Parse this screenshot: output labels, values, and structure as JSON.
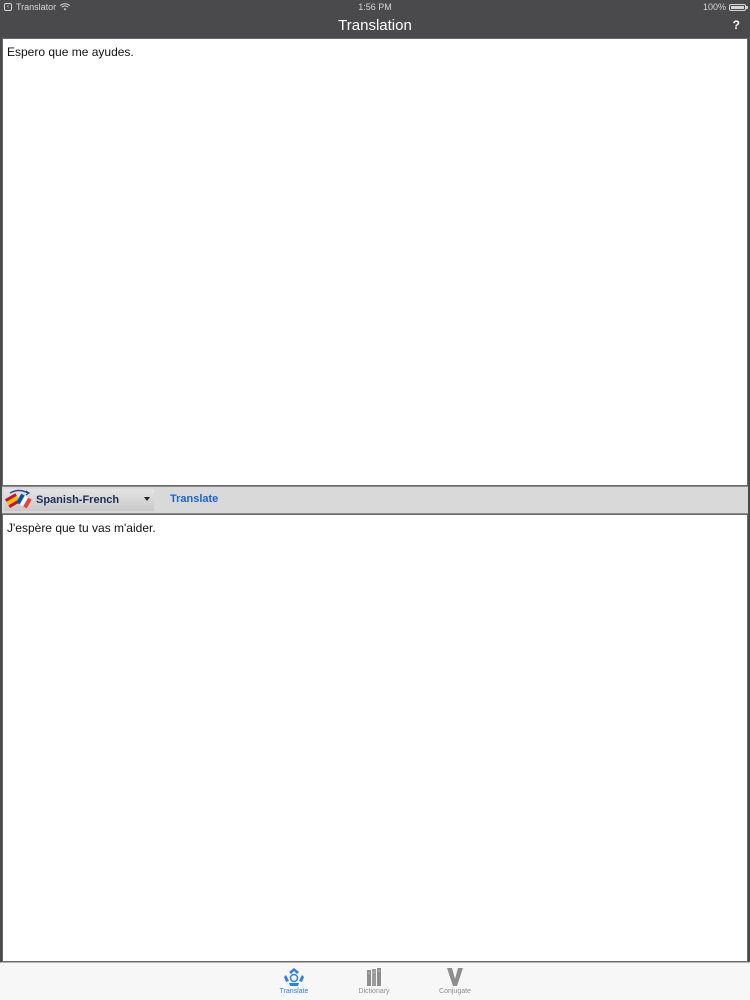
{
  "status_bar": {
    "app_name": "Translator",
    "time": "1:56 PM",
    "battery": "100%",
    "battery_level": 1.0
  },
  "nav": {
    "title": "Translation",
    "help_label": "?"
  },
  "source": {
    "text": "Espero que me ayudes."
  },
  "toolbar": {
    "language_pair": "Spanish-French",
    "translate_label": "Translate"
  },
  "target": {
    "text": "J'espère que tu vas m'aider."
  },
  "tabs": [
    {
      "label": "Translate",
      "icon": "translate-icon",
      "active": true
    },
    {
      "label": "Dictionary",
      "icon": "dictionary-icon",
      "active": false
    },
    {
      "label": "Conjugate",
      "icon": "conjugate-icon",
      "active": false
    }
  ],
  "colors": {
    "accent": "#2d7fe8",
    "bar_background": "#4a4a4c",
    "translate_link": "#1a63d6"
  }
}
